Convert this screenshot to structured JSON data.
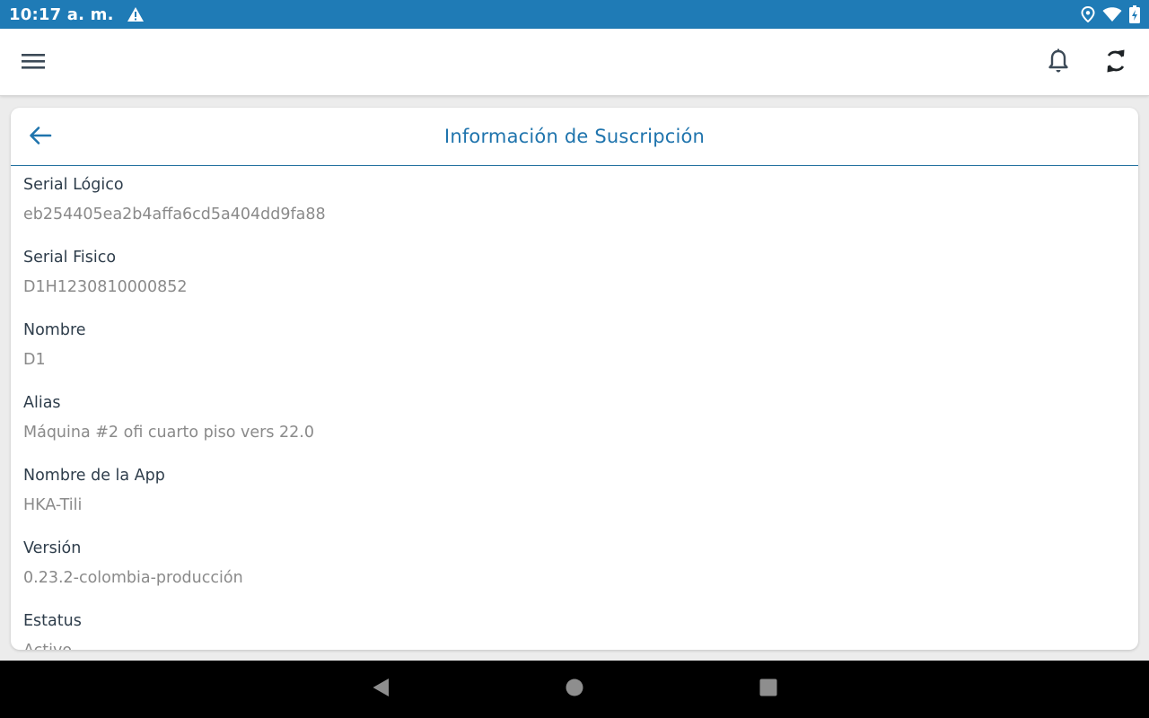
{
  "status_bar": {
    "time": "10:17 a. m.",
    "icons": [
      "warning-icon",
      "location-icon",
      "wifi-icon",
      "battery-charging-icon"
    ]
  },
  "toolbar": {
    "icons": [
      "menu-icon",
      "bell-icon",
      "sync-icon"
    ]
  },
  "colors": {
    "status_bar": "#1f7bb6",
    "accent": "#1f74ad",
    "label": "#2e3d4b",
    "value": "#8a8a8a"
  },
  "card": {
    "title": "Información de Suscripción",
    "back_icon": "arrow-left-icon",
    "fields": [
      {
        "label": "Serial Lógico",
        "value": "eb254405ea2b4affa6cd5a404dd9fa88"
      },
      {
        "label": "Serial Fisico",
        "value": "D1H1230810000852"
      },
      {
        "label": "Nombre",
        "value": "D1"
      },
      {
        "label": "Alias",
        "value": "Máquina #2 ofi cuarto piso vers 22.0"
      },
      {
        "label": "Nombre de la App",
        "value": "HKA-Tili"
      },
      {
        "label": "Versión",
        "value": "0.23.2-colombia-producción"
      },
      {
        "label": "Estatus",
        "value": "Activo"
      }
    ]
  },
  "nav_bar": {
    "icons": [
      "nav-back-icon",
      "nav-home-icon",
      "nav-recents-icon"
    ]
  }
}
